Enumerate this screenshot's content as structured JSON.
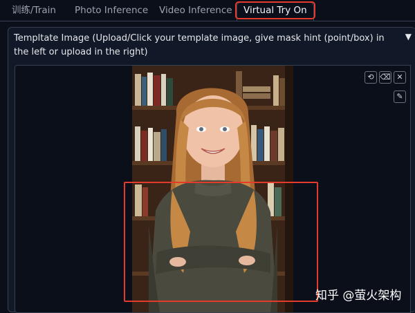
{
  "tabs": [
    {
      "label": "训练/Train"
    },
    {
      "label": "Photo Inference"
    },
    {
      "label": "Video Inference"
    },
    {
      "label": "Virtual Try On"
    }
  ],
  "panel": {
    "title": "Templtate Image (Upload/Click your template image, give mask hint (point/box) in the left or upload in the right)",
    "collapse_glyph": "▼"
  },
  "toolbar": {
    "undo_icon": "⟲",
    "erase_icon": "⌫",
    "close_icon": "✕",
    "brush_icon": "✎"
  },
  "watermark": "知乎 @萤火架构",
  "colors": {
    "accent_highlight": "#e53b2c",
    "background": "#0b0f19",
    "panel": "#111827",
    "border": "#374151"
  }
}
